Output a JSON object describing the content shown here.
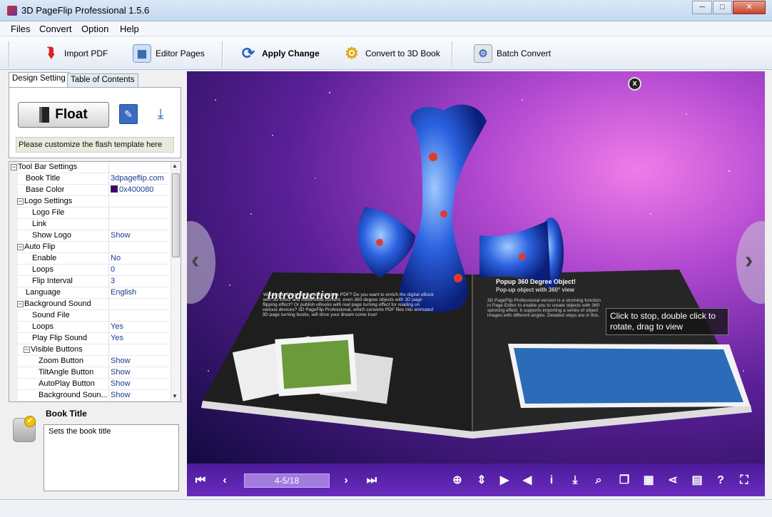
{
  "window": {
    "title": "3D PageFlip Professional 1.5.6",
    "controls": [
      "─",
      "□",
      "✕"
    ]
  },
  "menu": [
    "Files",
    "Convert",
    "Option",
    "Help"
  ],
  "toolbar": {
    "import_pdf": "Import PDF",
    "editor_pages": "Editor Pages",
    "apply_change": "Apply Change",
    "convert_3d": "Convert to 3D Book",
    "batch_convert": "Batch Convert"
  },
  "tabs": {
    "design": "Design Setting",
    "toc": "Table of Contents"
  },
  "design": {
    "float_label": "Float",
    "hint": "Please customize the flash template here"
  },
  "properties": [
    {
      "name": "Tool Bar Settings",
      "value": "",
      "level": 0,
      "expander": "−"
    },
    {
      "name": "Book Title",
      "value": "3dpageflip.com",
      "level": 1
    },
    {
      "name": "Base Color",
      "value": "0x400080",
      "level": 1,
      "swatch": "#400080"
    },
    {
      "name": "Logo Settings",
      "value": "",
      "level": 1,
      "expander": "−"
    },
    {
      "name": "Logo File",
      "value": "",
      "level": 2
    },
    {
      "name": "Link",
      "value": "",
      "level": 2
    },
    {
      "name": "Show Logo",
      "value": "Show",
      "level": 2
    },
    {
      "name": "Auto Flip",
      "value": "",
      "level": 1,
      "expander": "−"
    },
    {
      "name": "Enable",
      "value": "No",
      "level": 2
    },
    {
      "name": "Loops",
      "value": "0",
      "level": 2
    },
    {
      "name": "Flip Interval",
      "value": "3",
      "level": 2
    },
    {
      "name": "Language",
      "value": "English",
      "level": 1
    },
    {
      "name": "Background Sound",
      "value": "",
      "level": 1,
      "expander": "−"
    },
    {
      "name": "Sound File",
      "value": "",
      "level": 2
    },
    {
      "name": "Loops",
      "value": "Yes",
      "level": 2
    },
    {
      "name": "Play Flip Sound",
      "value": "Yes",
      "level": 2
    },
    {
      "name": "Visible Buttons",
      "value": "",
      "level": 2,
      "expander": "−"
    },
    {
      "name": "Zoom Button",
      "value": "Show",
      "level": 3
    },
    {
      "name": "TiltAngle Button",
      "value": "Show",
      "level": 3
    },
    {
      "name": "AutoPlay Button",
      "value": "Show",
      "level": 3
    },
    {
      "name": "Background Soun...",
      "value": "Show",
      "level": 3
    }
  ],
  "description": {
    "title": "Book Title",
    "text": "Sets the book title"
  },
  "book": {
    "left_heading": "Introduction",
    "left_text": "Would you like to vivify characterless PDF? Do you want to enrich the digital eBook with 3D effect and multimedia content, even 360-degree objects with 3D page flipping effect? Or publish eBooks with real page turning effect for reading on various devices? 3D PageFlip Professional, which converts PDF files into animated 3D page turning books, will drive your dream come true!",
    "right_heading": "Popup 360 Degree Object!",
    "right_subheading": "Pop-up object with 360° view",
    "right_text": "3D PageFlip Professional version is a stunning function in Page Editor to enable you to create objects with 360 spinning effect. It supports importing a series of object images with different angles. Detailed steps are in this."
  },
  "tooltip": "Click to stop, double click to rotate, drag to view",
  "close_label": "x",
  "navbar": {
    "page": "4-5/18"
  },
  "colors": {
    "brand": "#400080",
    "navbar": "#5a24ad"
  }
}
